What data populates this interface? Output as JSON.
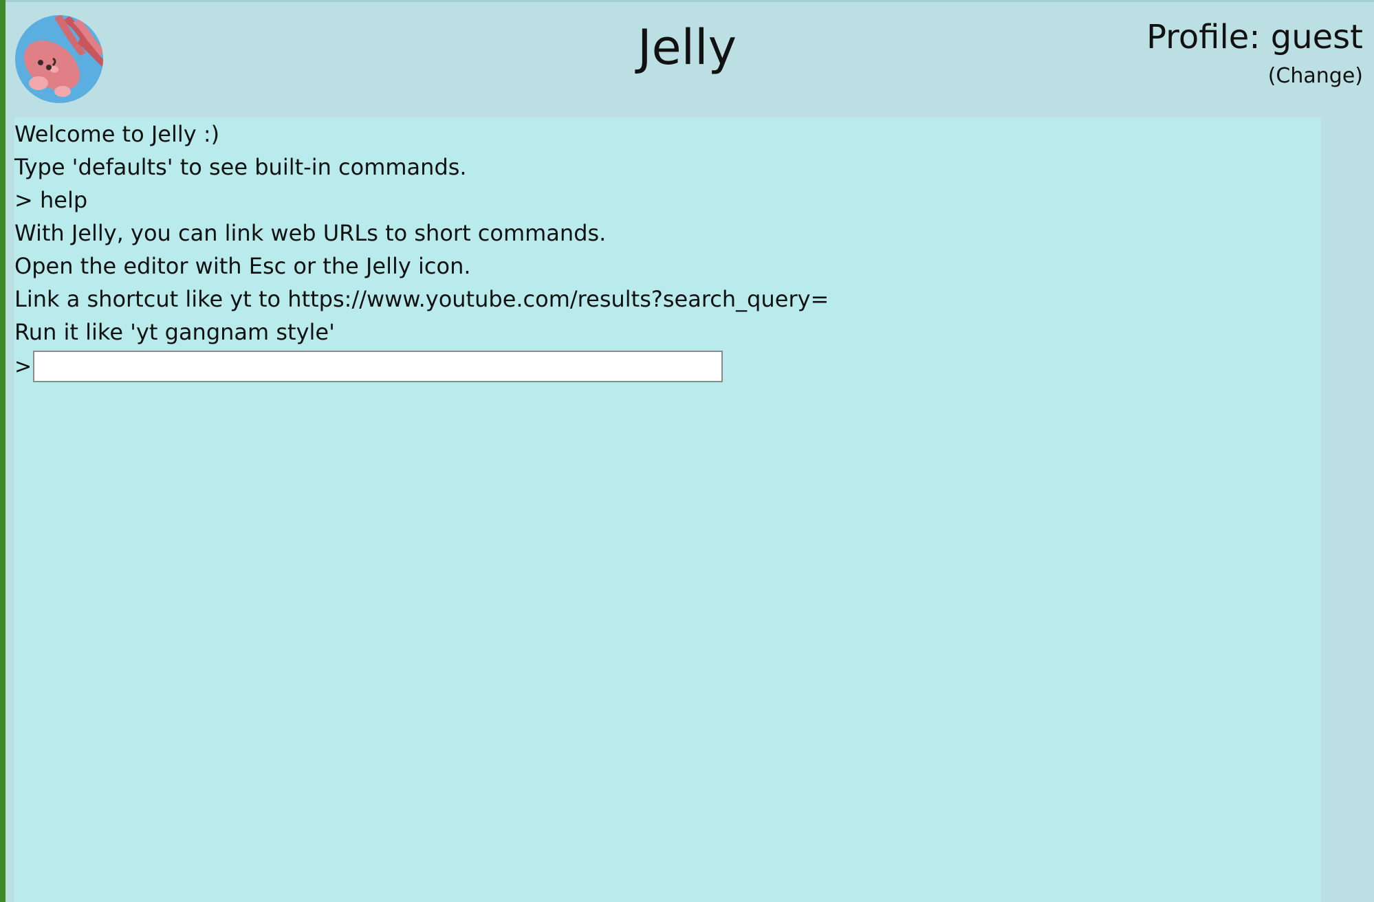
{
  "header": {
    "title": "Jelly",
    "profile_label": "Profile: guest",
    "change_label": "(Change)",
    "logo_icon": "jellyfish-logo-icon"
  },
  "terminal": {
    "lines": [
      "Welcome to Jelly :)",
      "Type 'defaults' to see built-in commands.",
      "> help",
      "With Jelly, you can link web URLs to short commands.",
      "Open the editor with Esc or the Jelly icon.",
      "Link a shortcut like yt to https://www.youtube.com/results?search_query=",
      "Run it like 'yt gangnam style'"
    ],
    "prompt_symbol": ">",
    "input_value": ""
  },
  "colors": {
    "background": "#bcdfe4",
    "terminal_background": "#b9ebec",
    "left_accent": "#3d8a2b",
    "logo_circle": "#5aaee0",
    "jellyfish_pink": "#e07f86"
  }
}
